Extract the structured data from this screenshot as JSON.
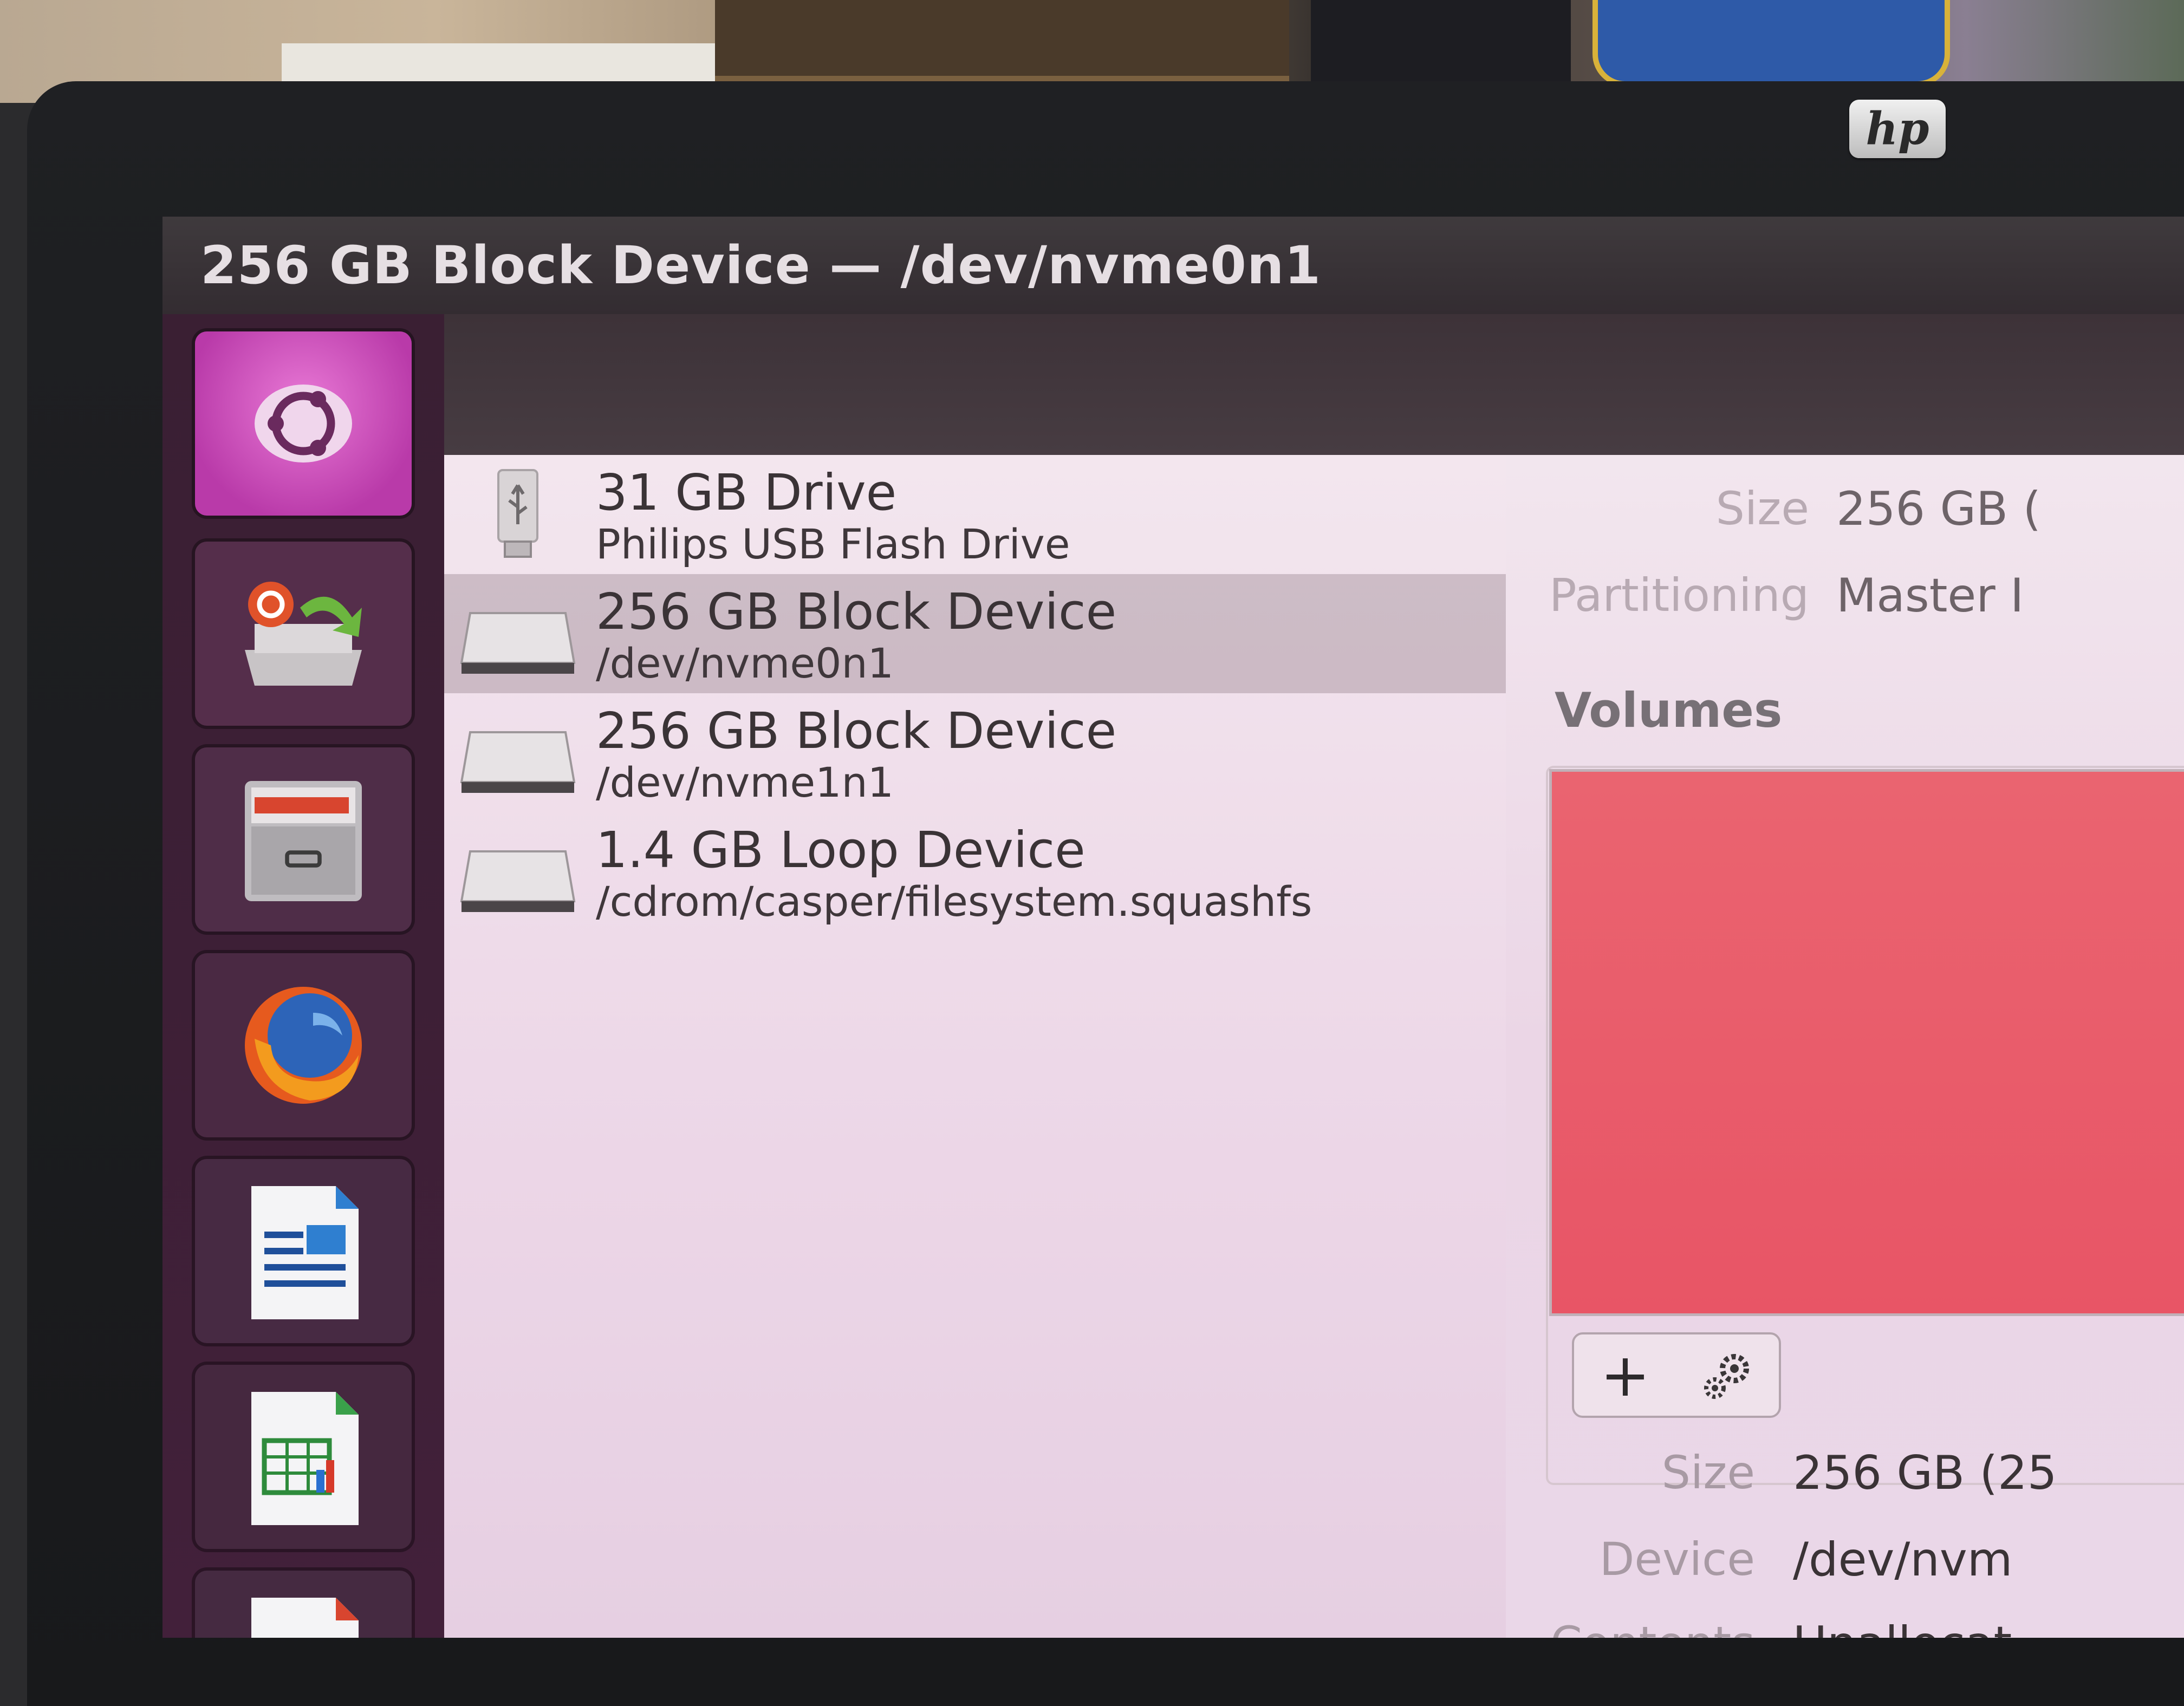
{
  "window": {
    "title": "256 GB Block Device — /dev/nvme0n1"
  },
  "monitor": {
    "brand": "hp"
  },
  "launcher": {
    "items": [
      {
        "icon": "ubuntu-dash-icon"
      },
      {
        "icon": "install-ubuntu-icon"
      },
      {
        "icon": "files-cabinet-icon"
      },
      {
        "icon": "firefox-icon"
      },
      {
        "icon": "libreoffice-impress-icon"
      },
      {
        "icon": "libreoffice-calc-icon"
      },
      {
        "icon": "libreoffice-writer-icon"
      }
    ]
  },
  "devices": [
    {
      "name": "31 GB Drive",
      "subtitle": "Philips USB Flash Drive",
      "icon": "usb-drive-icon",
      "selected": false
    },
    {
      "name": "256 GB Block Device",
      "subtitle": "/dev/nvme0n1",
      "icon": "disk-drive-icon",
      "selected": true
    },
    {
      "name": "256 GB Block Device",
      "subtitle": "/dev/nvme1n1",
      "icon": "disk-drive-icon",
      "selected": false
    },
    {
      "name": "1.4 GB Loop Device",
      "subtitle": "/cdrom/casper/filesystem.squashfs",
      "icon": "disk-drive-icon",
      "selected": false
    }
  ],
  "drive_info": {
    "size_label": "Size",
    "size_value": "256 GB (",
    "partitioning_label": "Partitioning",
    "partitioning_value": "Master I"
  },
  "volumes": {
    "title": "Volumes",
    "bar_color": "#e85a68",
    "add_button": "+",
    "settings_icon": "gears-icon"
  },
  "volume_info": {
    "size_label": "Size",
    "size_value": "256 GB (25",
    "device_label": "Device",
    "device_value": "/dev/nvm",
    "contents_label": "Contents",
    "contents_value": "Unallocat"
  }
}
